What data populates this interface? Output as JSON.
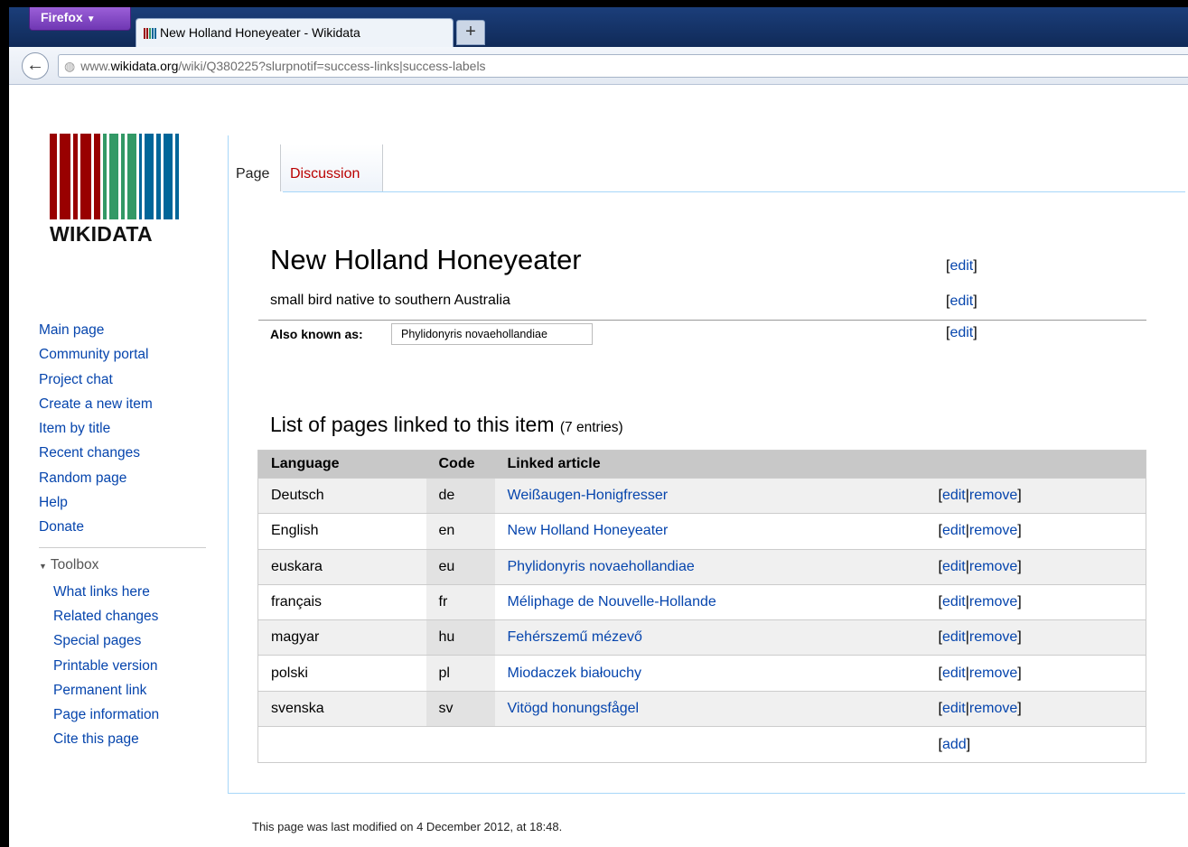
{
  "browser": {
    "menu_button": "Firefox",
    "tab_title": "New Holland Honeyeater - Wikidata",
    "new_tab": "+",
    "back": "←",
    "url_prefix": "www.",
    "url_domain": "wikidata.org",
    "url_path": "/wiki/Q380225?slurpnotif=success-links|success-labels"
  },
  "logo": {
    "text": "WIKIDATA",
    "colors": [
      "#990000",
      "#339966",
      "#006699"
    ]
  },
  "sidebar": {
    "nav": [
      "Main page",
      "Community portal",
      "Project chat",
      "Create a new item",
      "Item by title",
      "Recent changes",
      "Random page",
      "Help",
      "Donate"
    ],
    "toolbox_label": "Toolbox",
    "toolbox": [
      "What links here",
      "Related changes",
      "Special pages",
      "Printable version",
      "Permanent link",
      "Page information",
      "Cite this page"
    ]
  },
  "tabs": {
    "page": "Page",
    "discussion": "Discussion"
  },
  "item": {
    "label": "New Holland Honeyeater",
    "description": "small bird native to southern Australia",
    "aka_label": "Also known as:",
    "aka_value": "Phylidonyris novaehollandiae",
    "edit": "edit",
    "bracket_open": "[",
    "bracket_close": "]"
  },
  "sitelinks": {
    "title": "List of pages linked to this item",
    "count": "(7 entries)",
    "headers": {
      "language": "Language",
      "code": "Code",
      "article": "Linked article"
    },
    "rows": [
      {
        "language": "Deutsch",
        "code": "de",
        "article": "Weißaugen-Honigfresser"
      },
      {
        "language": "English",
        "code": "en",
        "article": "New Holland Honeyeater"
      },
      {
        "language": "euskara",
        "code": "eu",
        "article": "Phylidonyris novaehollandiae"
      },
      {
        "language": "français",
        "code": "fr",
        "article": "Méliphage de Nouvelle-Hollande"
      },
      {
        "language": "magyar",
        "code": "hu",
        "article": "Fehérszemű mézevő"
      },
      {
        "language": "polski",
        "code": "pl",
        "article": "Miodaczek białouchy"
      },
      {
        "language": "svenska",
        "code": "sv",
        "article": "Vitögd honungsfågel"
      }
    ],
    "edit": "edit",
    "separator": "|",
    "remove": "remove",
    "add": "add"
  },
  "footer": "This page was last modified on 4 December 2012, at 18:48."
}
